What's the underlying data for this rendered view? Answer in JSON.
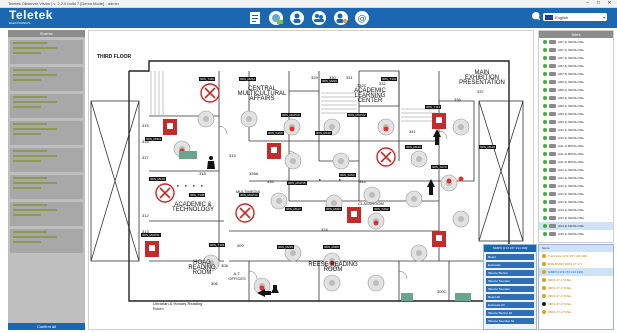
{
  "window": {
    "title": "Teletek Observer Vision | v. 2.2.0 build 7 [Demo Mode] - admin"
  },
  "header": {
    "logo_title": "Teletek",
    "logo_sub": "ELECTRONICS",
    "icons": [
      "report-icon",
      "map-icon",
      "user-icon",
      "users-icon",
      "user-settings-icon",
      "email-icon"
    ],
    "language": "English",
    "accent": "#1b67b2"
  },
  "events_panel": {
    "title": "Events",
    "footer": "Confirm all",
    "items": [
      {},
      {},
      {},
      {},
      {},
      {},
      {},
      {}
    ]
  },
  "map": {
    "floor_label": "THIRD FLOOR",
    "rooms": {
      "central": "CENTRAL MULTICULTURAL AFFAIRS",
      "academic_center": "ACADEMIC LEARNING CENTER",
      "main_exhibition": "MAIN EXHIBITION PRESENTATION",
      "academic_tech": "ACADEMIC & TECHNOLOGY",
      "multimedia": "MULTIMEDIA",
      "classroom": "CLASSROOM",
      "reese": "REESE READING ROOM",
      "hoag": "HOAG READING ROOM",
      "offices": "A.T. OFFICES",
      "librarian": "Librarian & Honors Reading Room"
    },
    "room_numbers": [
      "315",
      "316",
      "317",
      "312",
      "313",
      "318",
      "319",
      "329",
      "330",
      "331",
      "332C",
      "332",
      "336",
      "337",
      "341",
      "335",
      "344",
      "335A",
      "300A",
      "300C",
      "309",
      "308",
      "306",
      "324"
    ],
    "device_tags": [
      "IRIS_T110",
      "IRIS_M214",
      "IRIS_MCP30",
      "IRIS_M220",
      "IRIS_T131",
      "IRIS_M301",
      "IRIS_S150",
      "IRIS_M112",
      "IRIS_MCP32",
      "IRIS_T114",
      "IRIS_M140",
      "IRIS_S170",
      "IRIS_M120",
      "IRIS_S153",
      "IRIS_MCP35",
      "IRIS_M140",
      "IRIS_T108",
      "IRIS_MCP40",
      "IRIS_M117",
      "IRIS_M301",
      "IRIS_S152",
      "IRIS_MCP31",
      "IRIS_T133",
      "IRIS_M215",
      "IRIS_M305"
    ]
  },
  "sites_panel": {
    "title": "Sites",
    "items": [
      {
        "label": "[007.1] MIDSH REL"
      },
      {
        "label": "[007.2] MIDSH REL"
      },
      {
        "label": "[007.3] MIDSH REL"
      },
      {
        "label": "[007.4] MIDSH REL"
      },
      {
        "label": "[007.5] MIDSH REL"
      },
      {
        "label": "[008.1] MIDSH REL"
      },
      {
        "label": "[008.2] MIDSH REL"
      },
      {
        "label": "[008.3] MIDSH REL"
      },
      {
        "label": "[009.1] MIDSH REL"
      },
      {
        "label": "[009.2] MIDSH REL"
      },
      {
        "label": "[009.3] MIDSH REL"
      },
      {
        "label": "[010.1] MIDSH REL"
      },
      {
        "label": "[010.2] MIDSH REL"
      },
      {
        "label": "[011.1] MIDSH REL"
      },
      {
        "label": "[011.2] MIDSH REL"
      },
      {
        "label": "[011.3] MIDSH REL"
      },
      {
        "label": "[012.1] MIDSH REL"
      },
      {
        "label": "[012.2] MIDSH REL"
      },
      {
        "label": "[013.1] MIDSH REL"
      },
      {
        "label": "[013.2] MIDSH REL"
      },
      {
        "label": "[013.3] MIDSH REL"
      },
      {
        "label": "[014.1] MIDSH REL"
      },
      {
        "label": "[014.2] MIDSH REL"
      },
      {
        "label": "[014.3] MIDSH REL"
      },
      {
        "label": "[015.1] MIDSH REL"
      }
    ]
  },
  "context_menu": {
    "title": "SIMPO [172.157.134.199]",
    "items": [
      "Reset",
      "Evacuate",
      "Silence Buzzer",
      "Silence Sounder",
      "Silence Sounder",
      "Reset All",
      "Evacuate All",
      "Silence Buzzer All",
      "Silence Sounder All"
    ]
  },
  "status_popup": {
    "title": "Items",
    "items": [
      {
        "label": "Trenbalow [172.157.134.199]",
        "color": "#e0a020"
      },
      {
        "label": "BSE-BSMI2 [0001.27.17]",
        "color": "#e0a020"
      },
      {
        "label": "SIMPO [172.157.134.199]",
        "color": "#e0a020"
      },
      {
        "label": "[0001.27.17] REL",
        "color": "#e0a020"
      },
      {
        "label": "[0001.27.17] REL",
        "color": "#e0a020"
      },
      {
        "label": "[0001.27.17] REL",
        "color": "#e0a020"
      },
      {
        "label": "[0001.27.17] REL",
        "color": "#1b1b1b"
      },
      {
        "label": "[0001.27.17] REL",
        "color": "#e0a020"
      }
    ]
  }
}
